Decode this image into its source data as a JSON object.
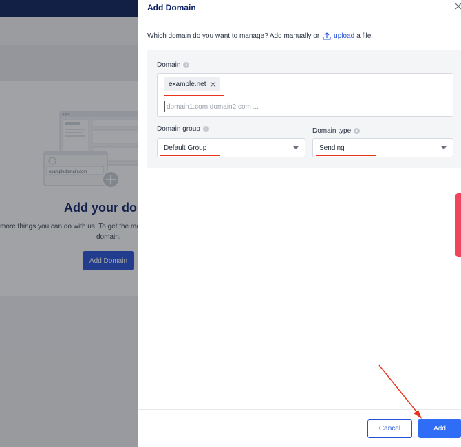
{
  "background": {
    "illustration_domain": "exampledomain.com",
    "heading": "Add your doma",
    "text_line1": "more things you can do with us. To get the most",
    "text_line2": "domain.",
    "add_button": "Add Domain"
  },
  "drawer": {
    "title": "Add Domain",
    "description_prefix": "Which domain do you want to manage? Add manually or",
    "upload_link": "upload",
    "description_suffix": "a file.",
    "domain": {
      "label": "Domain",
      "tags": [
        "example.net"
      ],
      "placeholder": "domain1.com domain2.com ..."
    },
    "domain_group": {
      "label": "Domain group",
      "selected": "Default Group"
    },
    "domain_type": {
      "label": "Domain type",
      "selected": "Sending"
    },
    "cancel_button": "Cancel",
    "add_button": "Add"
  },
  "colors": {
    "brand_navy": "#0b1f66",
    "primary": "#2551d6",
    "add_button": "#2f6df6",
    "annotation_red": "#e8341c",
    "side_tab": "#f0455a"
  },
  "icons": {
    "close": "close-icon",
    "upload": "upload-icon",
    "info": "info-icon",
    "tag_remove": "close-icon",
    "select_caret": "chevron-down-icon",
    "add_circle": "plus-icon"
  }
}
